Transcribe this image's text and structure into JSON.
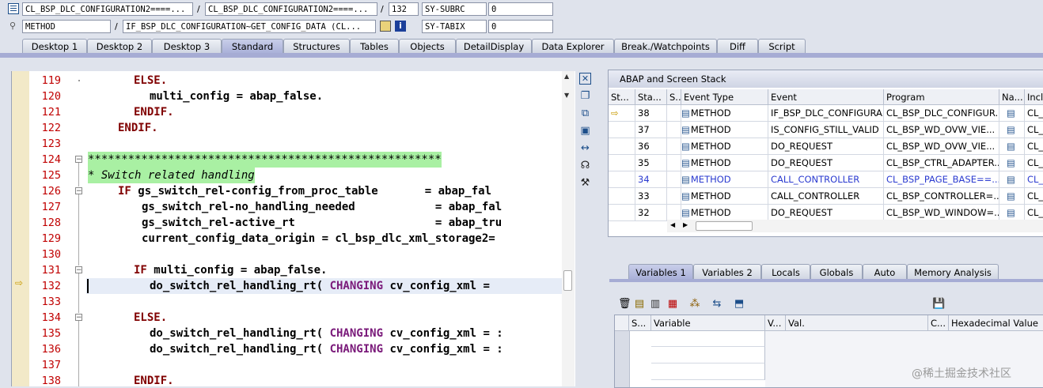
{
  "header": {
    "row1": {
      "f1": "CL_BSP_DLC_CONFIGURATION2====...",
      "sep1": "/",
      "f2": "CL_BSP_DLC_CONFIGURATION2====...",
      "sep2": "/",
      "line": "132",
      "sysvar": "SY-SUBRC",
      "sysval": "0"
    },
    "row2": {
      "f1": "METHOD",
      "sep1": "/",
      "f2": "IF_BSP_DLC_CONFIGURATION~GET_CONFIG_DATA (CL...",
      "sysvar": "SY-TABIX",
      "sysval": "0"
    }
  },
  "tabs": [
    "Desktop 1",
    "Desktop 2",
    "Desktop 3",
    "Standard",
    "Structures",
    "Tables",
    "Objects",
    "DetailDisplay",
    "Data Explorer",
    "Break./Watchpoints",
    "Diff",
    "Script"
  ],
  "active_tab": "Standard",
  "editor": {
    "line_numbers": [
      "119",
      "120",
      "121",
      "122",
      "123",
      "124",
      "125",
      "126",
      "127",
      "128",
      "129",
      "130",
      "131",
      "132",
      "133",
      "134",
      "135",
      "136",
      "137",
      "138"
    ],
    "current_line": "132"
  },
  "code": {
    "l119": "ELSE.",
    "l120a": "multi_config = abap_false.",
    "l121": "ENDIF.",
    "l122": "ENDIF.",
    "l124": "*****************************************************",
    "l125": "* Switch related handling",
    "l126a": "IF",
    "l126b": " gs_switch_rel-config_from_proc_table       = abap_fal",
    "l127": "gs_switch_rel-no_handling_needed            = abap_fal",
    "l128": "gs_switch_rel-active_rt                     = abap_tru",
    "l129": "current_config_data_origin = cl_bsp_dlc_xml_storage2=",
    "l131a": "IF",
    "l131b": " multi_config = abap_false.",
    "l132a": "do_switch_rel_handling_rt( ",
    "l132b": "CHANGING",
    "l132c": " cv_config_xml = ",
    "l134": "ELSE.",
    "l135a": "do_switch_rel_handling_rt( ",
    "l135b": "CHANGING",
    "l135c": " cv_config_xml = :",
    "l136a": "do_switch_rel_handling_rt( ",
    "l136b": "CHANGING",
    "l136c": " cv_config_xml = :",
    "l138": "ENDIF."
  },
  "stack": {
    "title": "ABAP and Screen Stack",
    "columns": [
      "St...",
      "Sta...",
      "S...",
      "Event Type",
      "Event",
      "Program",
      "Na...",
      "Inclu"
    ],
    "rows": [
      {
        "level": "38",
        "type": "METHOD",
        "event": "IF_BSP_DLC_CONFIGURA...",
        "program": "CL_BSP_DLC_CONFIGUR...",
        "incl": "CL_E",
        "current": true,
        "highlight": false
      },
      {
        "level": "37",
        "type": "METHOD",
        "event": "IS_CONFIG_STILL_VALID",
        "program": "CL_BSP_WD_OVW_VIE...",
        "incl": "CL_E",
        "current": false,
        "highlight": false
      },
      {
        "level": "36",
        "type": "METHOD",
        "event": "DO_REQUEST",
        "program": "CL_BSP_WD_OVW_VIE...",
        "incl": "CL_E",
        "current": false,
        "highlight": false
      },
      {
        "level": "35",
        "type": "METHOD",
        "event": "DO_REQUEST",
        "program": "CL_BSP_CTRL_ADAPTER...",
        "incl": "CL_E",
        "current": false,
        "highlight": false
      },
      {
        "level": "34",
        "type": "METHOD",
        "event": "CALL_CONTROLLER",
        "program": "CL_BSP_PAGE_BASE==...",
        "incl": "CL_E",
        "current": false,
        "highlight": true
      },
      {
        "level": "33",
        "type": "METHOD",
        "event": "CALL_CONTROLLER",
        "program": "CL_BSP_CONTROLLER=...",
        "incl": "CL_E",
        "current": false,
        "highlight": false
      },
      {
        "level": "32",
        "type": "METHOD",
        "event": "DO_REQUEST",
        "program": "CL_BSP_WD_WINDOW=...",
        "incl": "CL_E",
        "current": false,
        "highlight": false
      }
    ]
  },
  "var_tabs": [
    "Variables 1",
    "Variables 2",
    "Locals",
    "Globals",
    "Auto",
    "Memory Analysis"
  ],
  "active_var_tab": "Variables 1",
  "var_columns": [
    "S...",
    "Variable",
    "V...",
    "Val.",
    "C...",
    "Hexadecimal Value"
  ],
  "watermark": "@稀土掘金技术社区",
  "colors": {
    "accent": "#a6acd4",
    "line_number": "#c00000",
    "keyword": "#800000",
    "comment_bg": "#a9f0a3",
    "highlight_text": "#2b3bd0"
  }
}
